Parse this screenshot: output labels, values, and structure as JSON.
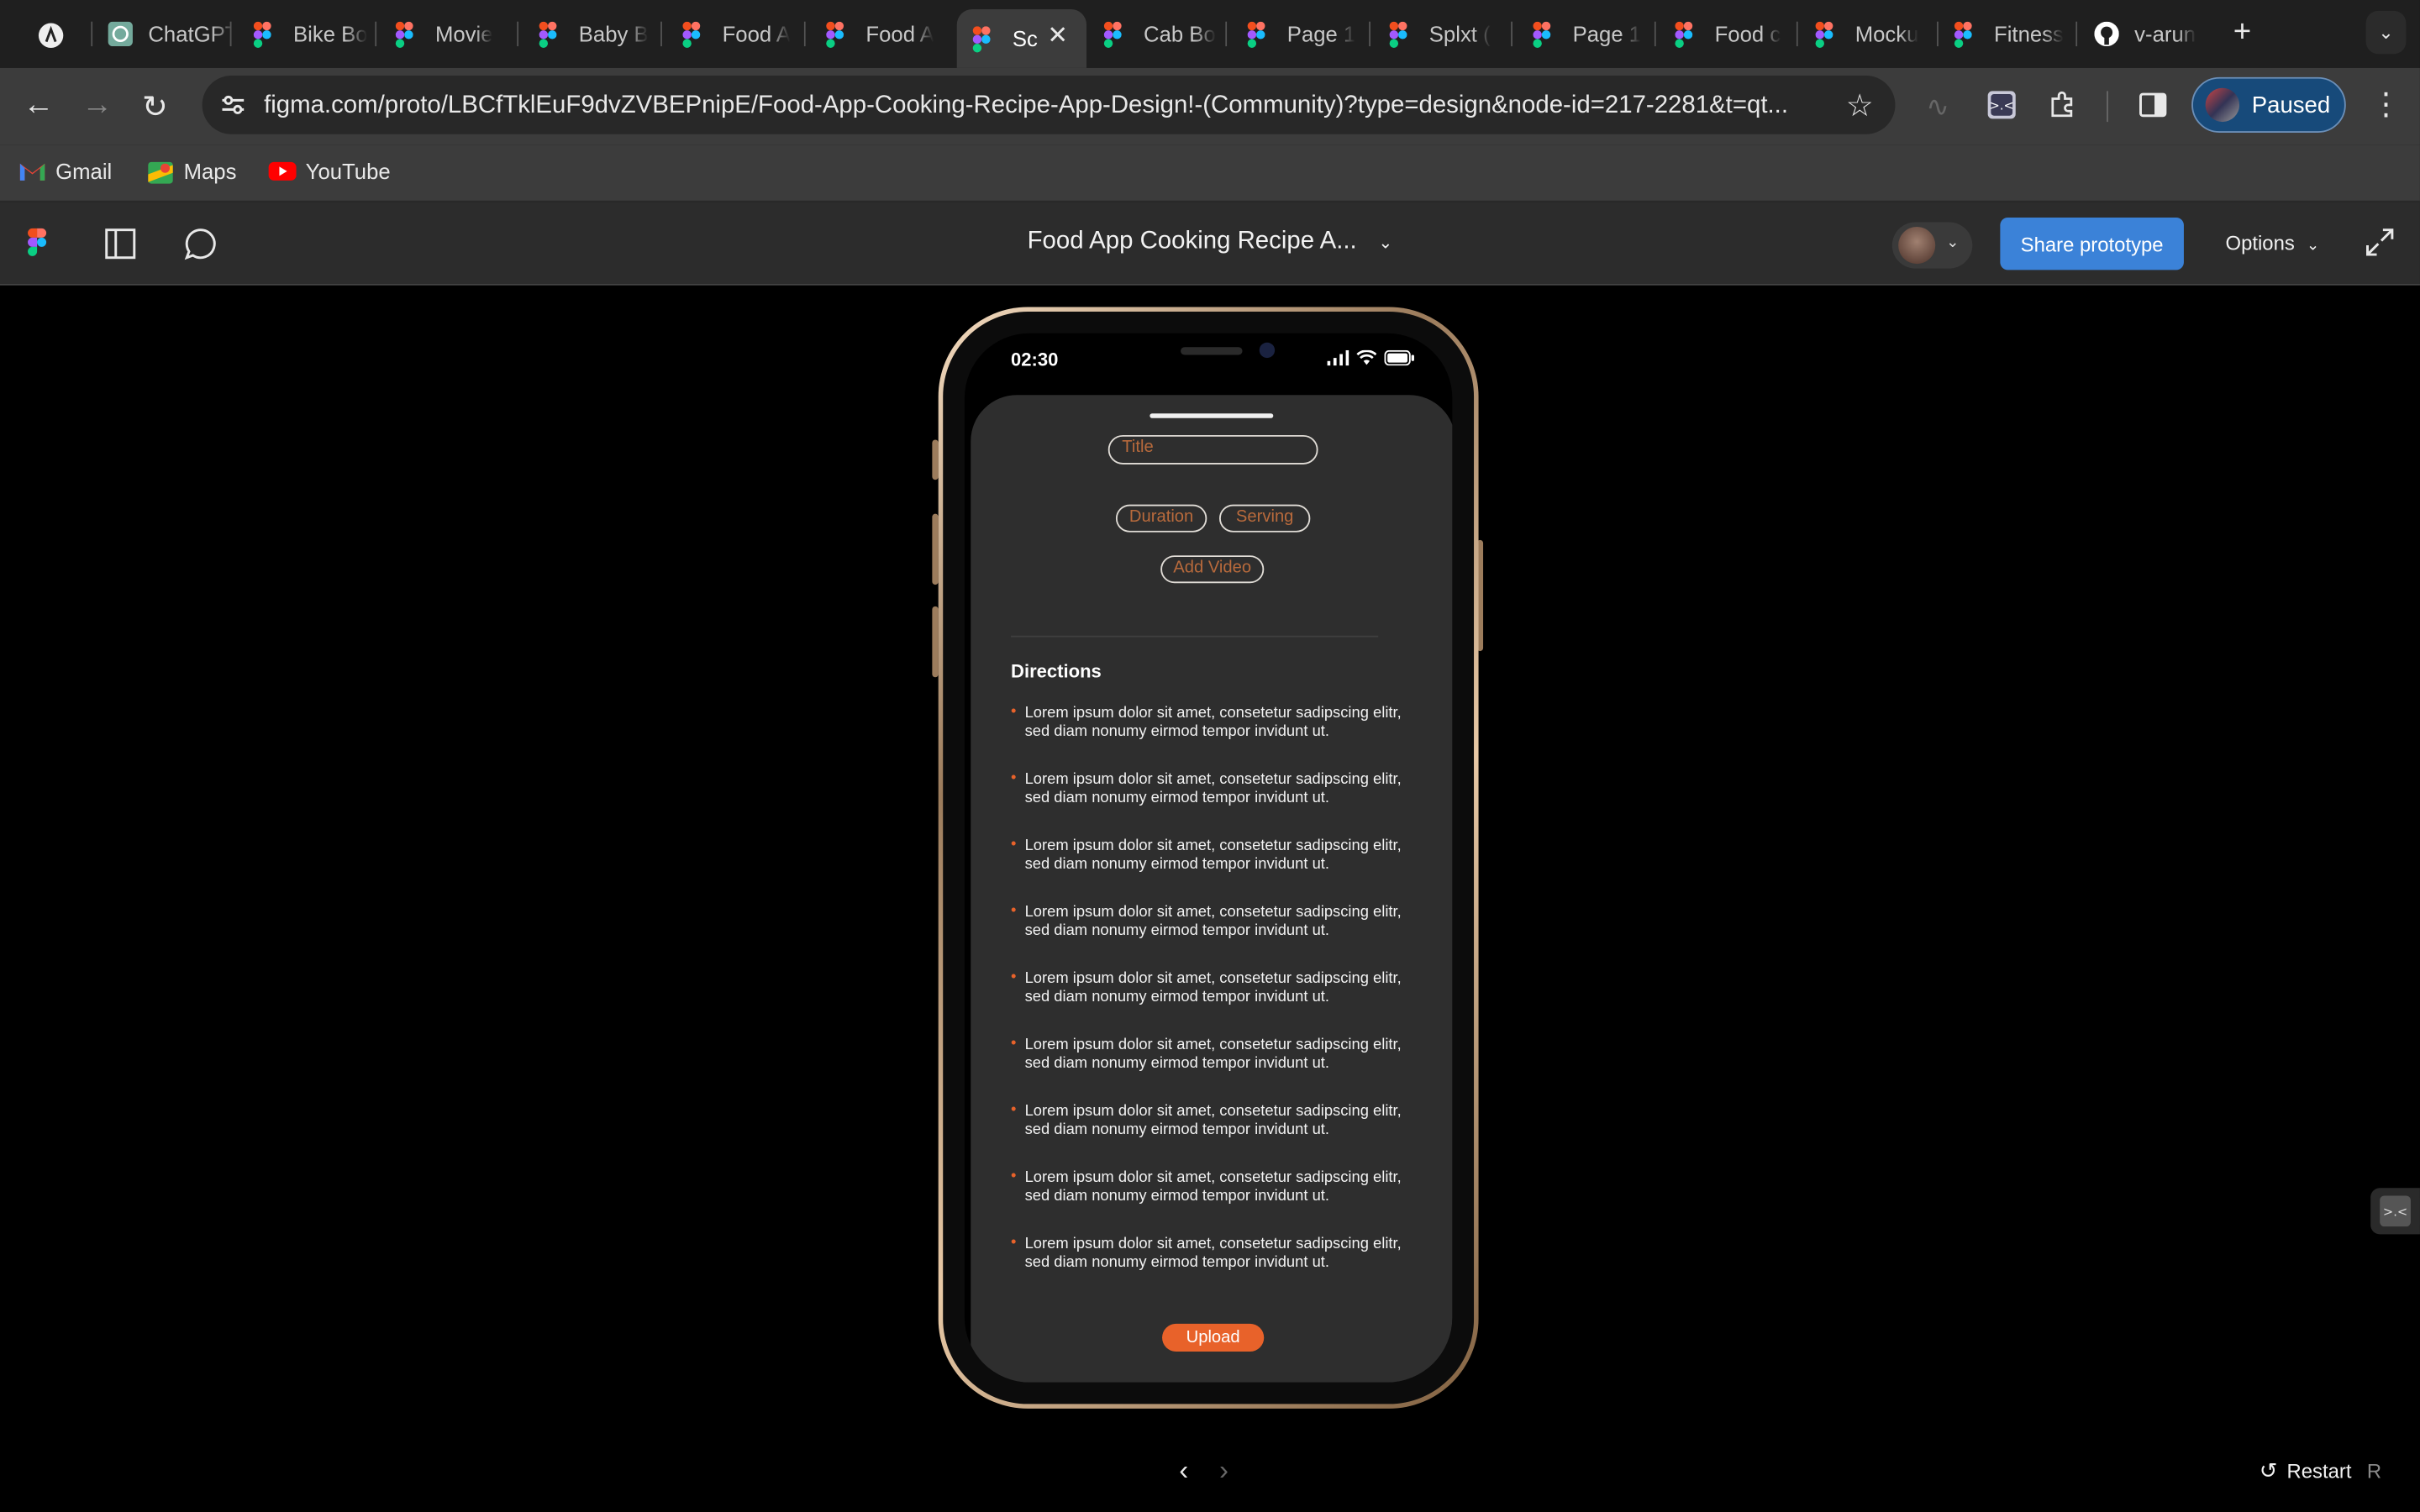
{
  "browser": {
    "tabs": [
      {
        "label": "",
        "icon": "perplexity-icon"
      },
      {
        "label": "ChatGPT",
        "icon": "chatgpt-icon"
      },
      {
        "label": "Bike Bo",
        "icon": "figma-icon"
      },
      {
        "label": "Movie",
        "icon": "figma-icon"
      },
      {
        "label": "Baby B",
        "icon": "figma-icon"
      },
      {
        "label": "Food A",
        "icon": "figma-icon"
      },
      {
        "label": "Food A",
        "icon": "figma-icon"
      },
      {
        "label": "Sc",
        "icon": "figma-icon",
        "active": true
      },
      {
        "label": "Cab Bo",
        "icon": "figma-icon"
      },
      {
        "label": "Page 1",
        "icon": "figma-icon"
      },
      {
        "label": "Splxt (",
        "icon": "figma-icon"
      },
      {
        "label": "Page 1",
        "icon": "figma-icon"
      },
      {
        "label": "Food c",
        "icon": "figma-icon"
      },
      {
        "label": "Mocku",
        "icon": "figma-icon"
      },
      {
        "label": "Fitness",
        "icon": "figma-icon"
      },
      {
        "label": "v-arun",
        "icon": "github-icon"
      }
    ],
    "new_tab_glyph": "+",
    "url": "figma.com/proto/LBCfTklEuF9dvZVBEPnipE/Food-App-Cooking-Recipe-App-Design!-(Community)?type=design&node-id=217-2281&t=qt...",
    "profile_label": "Paused",
    "bookmarks": [
      {
        "label": "Gmail",
        "icon": "gmail-icon"
      },
      {
        "label": "Maps",
        "icon": "maps-icon"
      },
      {
        "label": "YouTube",
        "icon": "youtube-icon"
      }
    ]
  },
  "figma": {
    "file_title": "Food App Cooking Recipe A...",
    "share_label": "Share prototype",
    "options_label": "Options",
    "restart_label": "Restart",
    "restart_key": "R"
  },
  "phone": {
    "time": "02:30",
    "title_placeholder": "Title",
    "duration_label": "Duration",
    "serving_label": "Serving",
    "add_video_label": "Add Video",
    "directions_title": "Directions",
    "directions": [
      "Lorem ipsum dolor sit amet, consetetur sadipscing elitr, sed diam nonumy eirmod tempor invidunt ut.",
      "Lorem ipsum dolor sit amet, consetetur sadipscing elitr, sed diam nonumy eirmod tempor invidunt ut.",
      "Lorem ipsum dolor sit amet, consetetur sadipscing elitr, sed diam nonumy eirmod tempor invidunt ut.",
      "Lorem ipsum dolor sit amet, consetetur sadipscing elitr, sed diam nonumy eirmod tempor invidunt ut.",
      "Lorem ipsum dolor sit amet, consetetur sadipscing elitr, sed diam nonumy eirmod tempor invidunt ut.",
      "Lorem ipsum dolor sit amet, consetetur sadipscing elitr, sed diam nonumy eirmod tempor invidunt ut.",
      "Lorem ipsum dolor sit amet, consetetur sadipscing elitr, sed diam nonumy eirmod tempor invidunt ut.",
      "Lorem ipsum dolor sit amet, consetetur sadipscing elitr, sed diam nonumy eirmod tempor invidunt ut.",
      "Lorem ipsum dolor sit amet, consetetur sadipscing elitr, sed diam nonumy eirmod tempor invidunt ut."
    ],
    "upload_label": "Upload"
  },
  "colors": {
    "accent": "#e8622a",
    "share_button": "#3b82d8",
    "sheet_bg": "#2e2e2e",
    "canvas_bg": "#000000"
  }
}
